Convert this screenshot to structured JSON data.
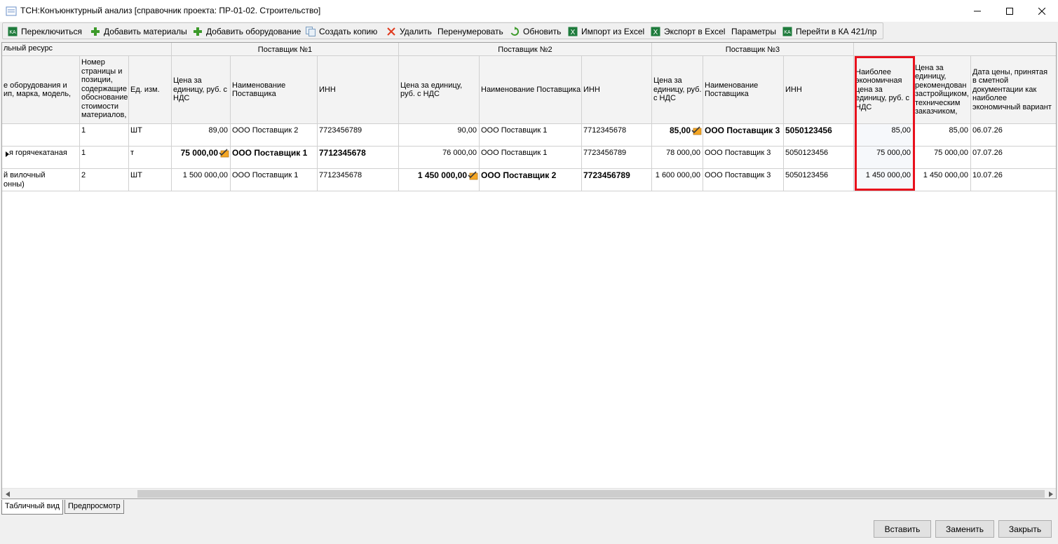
{
  "window": {
    "title": "ТСН:Конъюнктурный анализ [справочник проекта: ПР-01-02. Строительство]"
  },
  "toolbar": {
    "switch_label": "Переключиться",
    "add_materials_label": "Добавить материалы",
    "add_equipment_label": "Добавить оборудование",
    "copy_label": "Создать копию",
    "delete_label": "Удалить",
    "renumber_label": "Перенумеровать",
    "refresh_label": "Обновить",
    "import_excel_label": "Импорт из Excel",
    "export_excel_label": "Экспорт в Excel",
    "params_label": "Параметры",
    "goto_ka_label": "Перейти в КА 421/пр"
  },
  "grid": {
    "group_headers": {
      "resource": "льный ресурс",
      "supplier1": "Поставщик №1",
      "supplier2": "Поставщик №2",
      "supplier3": "Поставщик №3"
    },
    "columns": {
      "name": "е оборудования и\nип, марка, модель,",
      "page_num": "Номер\nстраницы и\nпозиции,\nсодержащие\nобоснование\nстоимости\nматериалов,",
      "unit": "Ед. изм.",
      "s1_price": "Цена за\nединицу, руб. с\nНДС",
      "s1_name": "Наименование\nПоставщика",
      "s1_inn": "ИНН",
      "s2_price": "Цена за единицу,\nруб. с НДС",
      "s2_name": "Наименование Поставщика",
      "s2_inn": "ИНН",
      "s3_price": "Цена за\nединицу, руб.\nс НДС",
      "s3_name": "Наименование\nПоставщика",
      "s3_inn": "ИНН",
      "best_price": "Наиболее\nэкономичная\nцена за\nединицу, руб. с\nНДС",
      "rec_price": "Цена за\nединицу,\nрекомендован\nзастройщиком,\nтехническим\nзаказчиком,",
      "price_date": "Дата цены, принятая\nв сметной\nдокументации как\nнаиболее\nэкономичный вариант"
    },
    "rows": [
      {
        "name": "",
        "page_num": "1",
        "unit": "ШТ",
        "s1_price": "89,00",
        "s1_name": "ООО Поставщик 2",
        "s1_inn": "7723456789",
        "s2_price": "90,00",
        "s2_name": "ООО Поставщик 1",
        "s2_inn": "7712345678",
        "s3_price": "85,00",
        "s3_name": "ООО Поставщик 3",
        "s3_inn": "5050123456",
        "best_price": "85,00",
        "rec_price": "85,00",
        "price_date": "06.07.26"
      },
      {
        "name": "я горячекатаная",
        "page_num": "1",
        "unit": "т",
        "s1_price": "75 000,00",
        "s1_name": "ООО Поставщик 1",
        "s1_inn": "7712345678",
        "s2_price": "76 000,00",
        "s2_name": "ООО Поставщик 1",
        "s2_inn": "7723456789",
        "s3_price": "78 000,00",
        "s3_name": "ООО Поставщик 3",
        "s3_inn": "5050123456",
        "best_price": "75 000,00",
        "rec_price": "75 000,00",
        "price_date": "07.07.26"
      },
      {
        "name": "й вилочный\nонны)",
        "page_num": "2",
        "unit": "ШТ",
        "s1_price": "1 500 000,00",
        "s1_name": "ООО Поставщик 1",
        "s1_inn": "7712345678",
        "s2_price": "1 450 000,00",
        "s2_name": "ООО Поставщик 2",
        "s2_inn": "7723456789",
        "s3_price": "1 600 000,00",
        "s3_name": "ООО Поставщик 3",
        "s3_inn": "5050123456",
        "best_price": "1 450 000,00",
        "rec_price": "1 450 000,00",
        "price_date": "10.07.26"
      }
    ]
  },
  "tabs": {
    "table_view": "Табличный вид",
    "preview": "Предпросмотр"
  },
  "buttons": {
    "insert": "Вставить",
    "replace": "Заменить",
    "close": "Закрыть"
  },
  "colors": {
    "highlight": "#e8101c",
    "excel_green": "#1e7b3c",
    "add_green": "#3c9a2a",
    "delete_red": "#e03a1e"
  }
}
